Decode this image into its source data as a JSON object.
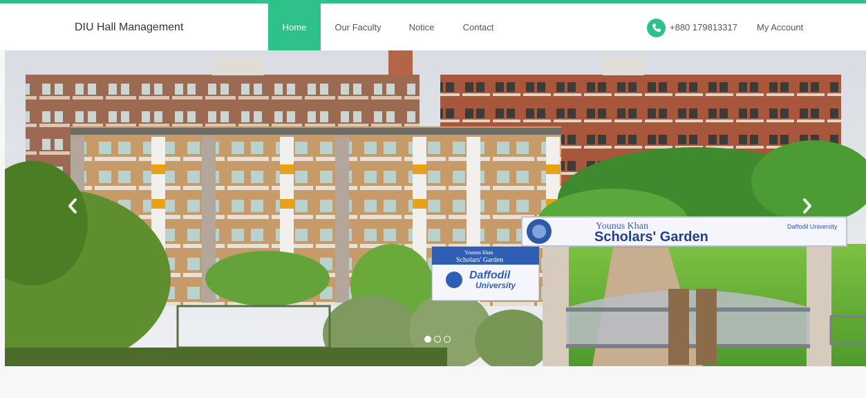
{
  "brand": "DIU Hall Management",
  "nav": {
    "home": "Home",
    "faculty": "Our Faculty",
    "notice": "Notice",
    "contact": "Contact"
  },
  "phone": "+880 179813317",
  "account": "My Account",
  "slide": {
    "garden_sign_top": "Younus Khan",
    "garden_sign_main": "Scholars' Garden",
    "garden_sign_brand": "Daffodil University",
    "small_sign_top": "Younus khan",
    "small_sign_mid": "Scholars' Garden",
    "small_sign_brand": "Daffodil",
    "small_sign_brand2": "University"
  },
  "colors": {
    "accent": "#2ec28a"
  },
  "icons": {
    "phone": "phone-icon",
    "prev": "chevron-left-icon",
    "next": "chevron-right-icon"
  },
  "carousel": {
    "slide_count": 3,
    "active_index": 0
  }
}
